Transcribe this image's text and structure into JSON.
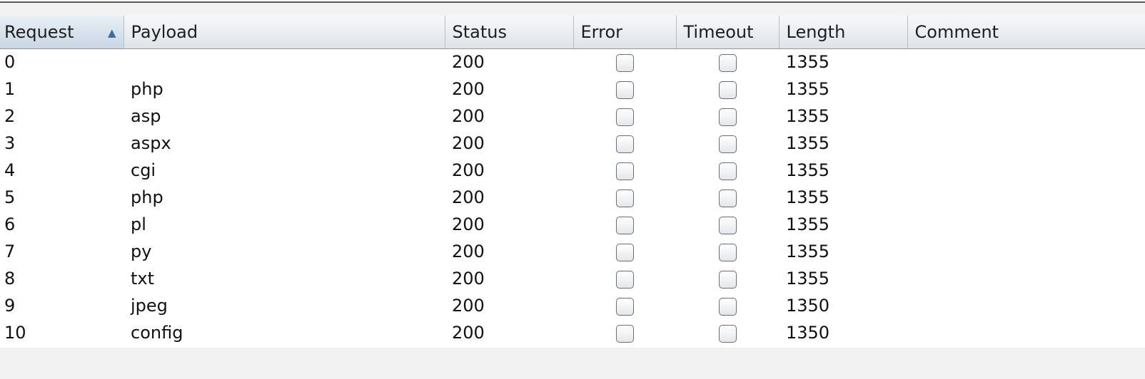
{
  "columns": {
    "request": "Request",
    "payload": "Payload",
    "status": "Status",
    "error": "Error",
    "timeout": "Timeout",
    "length": "Length",
    "comment": "Comment"
  },
  "sort": {
    "column": "request",
    "direction": "ascending",
    "icon": "sort-ascending-icon"
  },
  "rows": [
    {
      "request": "0",
      "payload": "",
      "status": "200",
      "error": false,
      "timeout": false,
      "length": "1355",
      "comment": ""
    },
    {
      "request": "1",
      "payload": "php",
      "status": "200",
      "error": false,
      "timeout": false,
      "length": "1355",
      "comment": ""
    },
    {
      "request": "2",
      "payload": "asp",
      "status": "200",
      "error": false,
      "timeout": false,
      "length": "1355",
      "comment": ""
    },
    {
      "request": "3",
      "payload": "aspx",
      "status": "200",
      "error": false,
      "timeout": false,
      "length": "1355",
      "comment": ""
    },
    {
      "request": "4",
      "payload": "cgi",
      "status": "200",
      "error": false,
      "timeout": false,
      "length": "1355",
      "comment": ""
    },
    {
      "request": "5",
      "payload": "php",
      "status": "200",
      "error": false,
      "timeout": false,
      "length": "1355",
      "comment": ""
    },
    {
      "request": "6",
      "payload": "pl",
      "status": "200",
      "error": false,
      "timeout": false,
      "length": "1355",
      "comment": ""
    },
    {
      "request": "7",
      "payload": "py",
      "status": "200",
      "error": false,
      "timeout": false,
      "length": "1355",
      "comment": ""
    },
    {
      "request": "8",
      "payload": "txt",
      "status": "200",
      "error": false,
      "timeout": false,
      "length": "1355",
      "comment": ""
    },
    {
      "request": "9",
      "payload": "jpeg",
      "status": "200",
      "error": false,
      "timeout": false,
      "length": "1350",
      "comment": ""
    },
    {
      "request": "10",
      "payload": "config",
      "status": "200",
      "error": false,
      "timeout": false,
      "length": "1350",
      "comment": ""
    }
  ]
}
